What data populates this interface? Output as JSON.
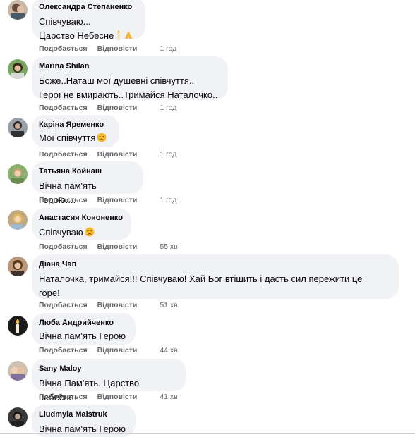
{
  "labels": {
    "like": "Подобається",
    "reply": "Відповісти"
  },
  "comments": [
    {
      "author": "Олександра Степаненко",
      "lines": [
        "Співчуваю...",
        "Царство Небесне"
      ],
      "emoji": [
        "candle-emoji",
        "praying-hands-emoji"
      ],
      "time": "1 год"
    },
    {
      "author": "Marina Shilan",
      "lines": [
        "Боже..Наташ мої душевні співчуття..",
        "Герої не вмирають..Тримайся Наталочко.."
      ],
      "time": "1 год"
    },
    {
      "author": "Каріна Яременко",
      "lines": [
        "Мої співчуття"
      ],
      "emoji": [
        "sad-tear-emoji"
      ],
      "time": "1 год"
    },
    {
      "author": "Татьяна Койнаш",
      "lines": [
        "Вічна пам'ять Герою...."
      ],
      "time": "1 год"
    },
    {
      "author": "Анастасия Кононенко",
      "lines": [
        "Співчуваю"
      ],
      "emoji": [
        "sad-face-emoji"
      ],
      "time": "55 хв"
    },
    {
      "author": "Діана Чап",
      "lines": [
        "Наталочка, тримайся!!! Співчуваю! Хай Бог втішить і дасть сил пережити це",
        "горе!"
      ],
      "time": "51 хв"
    },
    {
      "author": "Люба Андрийченко",
      "lines": [
        "Вічна пам'ять Герою"
      ],
      "time": "44 хв"
    },
    {
      "author": "Sany Maloy",
      "lines": [
        "Вічна Пам'ять. Царство небесне."
      ],
      "time": "41 хв"
    },
    {
      "author": "Liudmyla Maistruk",
      "lines": [
        "Вічна пам'ять Герою"
      ]
    }
  ]
}
